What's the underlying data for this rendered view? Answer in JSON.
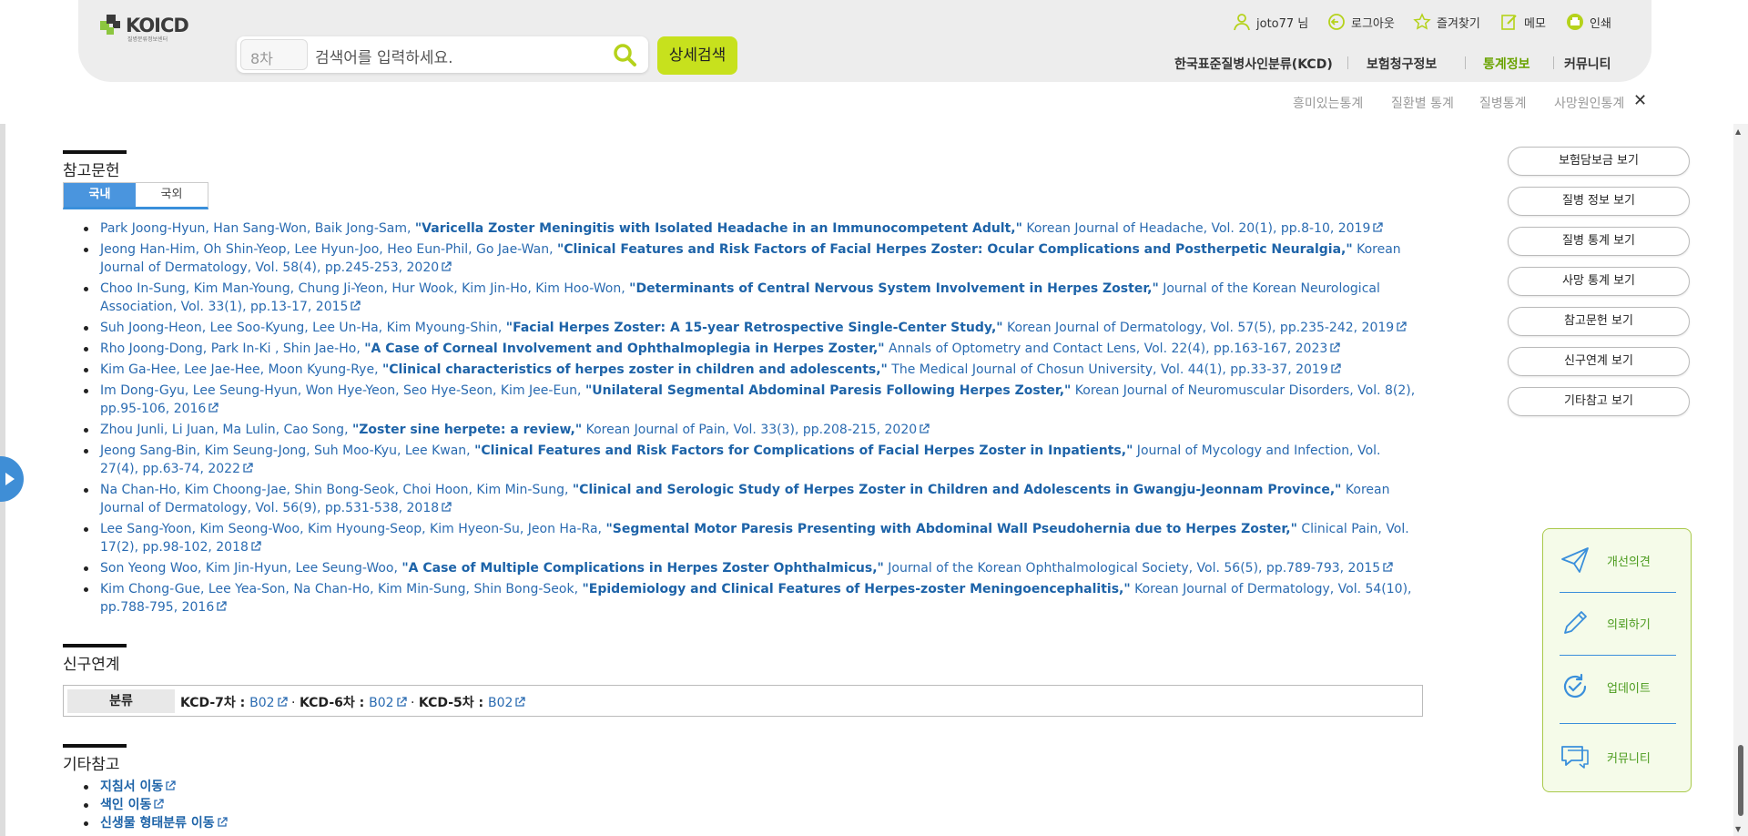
{
  "header": {
    "logo": "KOICD",
    "logo_sub": "질병분류정보센터",
    "search_version": "8차",
    "search_placeholder": "검색어를 입력하세요.",
    "detail_search": "상세검색",
    "user": "joto77 님",
    "logout": "로그아웃",
    "favorites": "즐겨찾기",
    "memo": "메모",
    "print": "인쇄",
    "gnb": [
      "한국표준질병사인분류(KCD)",
      "보험청구정보",
      "통계정보",
      "커뮤니티"
    ],
    "subnav": [
      "흥미있는통계",
      "질환별 통계",
      "질병통계",
      "사망원인통계"
    ],
    "close": "✕"
  },
  "references": {
    "title": "참고문헌",
    "tabs": [
      "국내",
      "국외"
    ],
    "items": [
      {
        "authors": "Park Joong-Hyun, Han Sang-Won, Baik Jong-Sam, ",
        "title": "\"Varicella Zoster Meningitis with Isolated Headache in an Immunocompetent Adult,\"",
        "source": " Korean Journal of Headache, Vol. 20(1), pp.8-10, 2019"
      },
      {
        "authors": "Jeong Han-Him, Oh Shin-Yeop, Lee Hyun-Joo, Heo Eun-Phil, Go Jae-Wan, ",
        "title": "\"Clinical Features and Risk Factors of Facial Herpes Zoster: Ocular Complications and Postherpetic Neuralgia,\"",
        "source": " Korean Journal of Dermatology, Vol. 58(4), pp.245-253, 2020"
      },
      {
        "authors": "Choo In-Sung, Kim Man-Young, Chung Ji-Yeon, Hur Wook, Kim Jin-Ho, Kim Hoo-Won, ",
        "title": "\"Determinants of Central Nervous System Involvement in Herpes Zoster,\"",
        "source": " Journal of the Korean Neurological Association, Vol. 33(1), pp.13-17, 2015"
      },
      {
        "authors": "Suh Joong-Heon, Lee Soo-Kyung, Lee Un-Ha, Kim Myoung-Shin, ",
        "title": "\"Facial Herpes Zoster: A 15-year Retrospective Single-Center Study,\"",
        "source": " Korean Journal of Dermatology, Vol. 57(5), pp.235-242, 2019"
      },
      {
        "authors": "Rho Joong-Dong, Park In-Ki , Shin Jae-Ho, ",
        "title": "\"A Case of Corneal Involvement and Ophthalmoplegia in Herpes Zoster,\"",
        "source": " Annals of Optometry and Contact Lens, Vol. 22(4), pp.163-167, 2023"
      },
      {
        "authors": "Kim Ga-Hee, Lee Jae-Hee, Moon Kyung-Rye, ",
        "title": "\"Clinical characteristics of herpes zoster in children and adolescents,\"",
        "source": " The Medical Journal of Chosun University, Vol. 44(1), pp.33-37, 2019"
      },
      {
        "authors": "Im Dong-Gyu, Lee Seung-Hyun, Won Hye-Yeon, Seo Hye-Seon, Kim Jee-Eun, ",
        "title": "\"Unilateral Segmental Abdominal Paresis Following Herpes Zoster,\"",
        "source": " Korean Journal of Neuromuscular Disorders, Vol. 8(2), pp.95-106, 2016"
      },
      {
        "authors": "Zhou Junli, Li Juan, Ma Lulin, Cao Song, ",
        "title": "\"Zoster sine herpete: a review,\"",
        "source": " Korean Journal of Pain, Vol. 33(3), pp.208-215, 2020"
      },
      {
        "authors": "Jeong Sang-Bin, Kim Seung-Jong, Suh Moo-Kyu, Lee Kwan, ",
        "title": "\"Clinical Features and Risk Factors for Complications of Facial Herpes Zoster in Inpatients,\"",
        "source": " Journal of Mycology and Infection, Vol. 27(4), pp.63-74, 2022"
      },
      {
        "authors": "Na Chan-Ho, Kim Choong-Jae, Shin Bong-Seok, Choi Hoon, Kim Min-Sung, ",
        "title": "\"Clinical and Serologic Study of Herpes Zoster in Children and Adolescents in Gwangju-Jeonnam Province,\"",
        "source": " Korean Journal of Dermatology, Vol. 56(9), pp.531-538, 2018"
      },
      {
        "authors": "Lee Sang-Yoon, Kim Seong-Woo, Kim Hyoung-Seop, Kim Hyeon-Su, Jeon Ha-Ra, ",
        "title": "\"Segmental Motor Paresis Presenting with Abdominal Wall Pseudohernia due to Herpes Zoster,\"",
        "source": " Clinical Pain, Vol. 17(2), pp.98-102, 2018"
      },
      {
        "authors": "Son Yeong Woo, Kim Jin-Hyun, Lee Seung-Woo, ",
        "title": "\"A Case of Multiple Complications in Herpes Zoster Ophthalmicus,\"",
        "source": " Journal of the Korean Ophthalmological Society, Vol. 56(5), pp.789-793, 2015"
      },
      {
        "authors": "Kim Chong-Gue, Lee Yea-Son, Na Chan-Ho, Kim Min-Sung, Shin Bong-Seok, ",
        "title": "\"Epidemiology and Clinical Features of Herpes-zoster Meningoencephalitis,\"",
        "source": " Korean Journal of Dermatology, Vol. 54(10), pp.788-795, 2016"
      }
    ]
  },
  "linkage": {
    "title": "신구연계",
    "label": "분류",
    "kcd7_label": "KCD-7차 : ",
    "kcd7": "B02",
    "kcd6_label": "KCD-6차 : ",
    "kcd6": "B02",
    "kcd5_label": "KCD-5차 : ",
    "kcd5": "B02",
    "dot": " · "
  },
  "etc": {
    "title": "기타참고",
    "items": [
      "지침서 이동",
      "색인 이동",
      "신생물 형태분류 이동"
    ]
  },
  "side_buttons": [
    "보험담보금 보기",
    "질병 정보 보기",
    "질병 통계 보기",
    "사망 통계 보기",
    "참고문헌 보기",
    "신구연계 보기",
    "기타참고 보기"
  ],
  "quick_menu": [
    "개선의견",
    "의뢰하기",
    "업데이트",
    "커뮤니티"
  ],
  "colors": {
    "accent_green": "#c7e11d",
    "link_blue": "#1d63a8",
    "tab_blue": "#4a95de"
  }
}
